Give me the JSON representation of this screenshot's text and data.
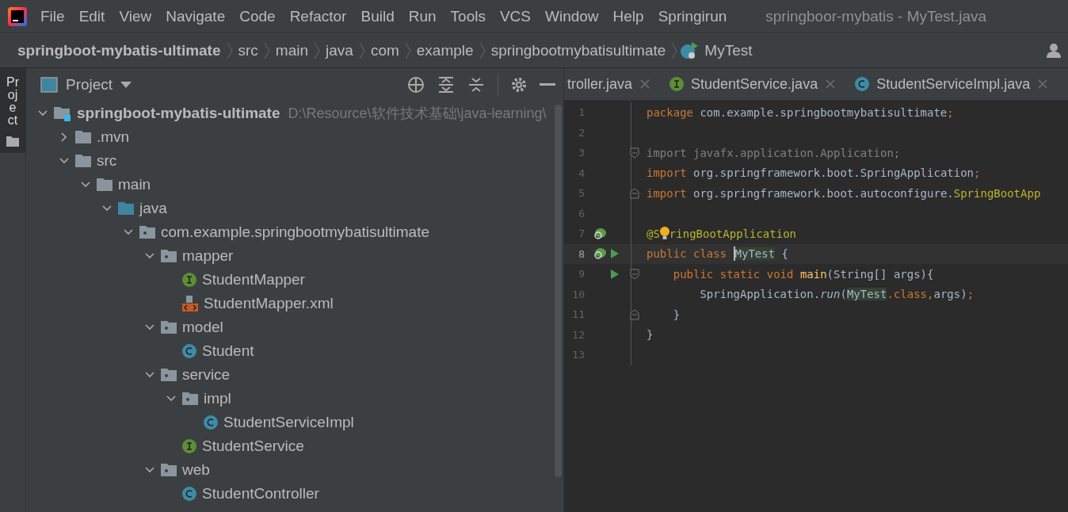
{
  "menu": {
    "items": [
      "File",
      "Edit",
      "View",
      "Navigate",
      "Code",
      "Refactor",
      "Build",
      "Run",
      "Tools",
      "VCS",
      "Window",
      "Help",
      "Springirun"
    ],
    "title": "springboor-mybatis - MyTest.java"
  },
  "breadcrumb": {
    "items": [
      {
        "label": "springboot-mybatis-ultimate",
        "kind": "project"
      },
      {
        "label": "src",
        "kind": "folder"
      },
      {
        "label": "main",
        "kind": "folder"
      },
      {
        "label": "java",
        "kind": "folder"
      },
      {
        "label": "com",
        "kind": "folder"
      },
      {
        "label": "example",
        "kind": "folder"
      },
      {
        "label": "springbootmybatisultimate",
        "kind": "folder"
      },
      {
        "label": "MyTest",
        "kind": "class"
      }
    ]
  },
  "side_strip": {
    "label": "Project"
  },
  "project_panel": {
    "title": "Project",
    "tree": [
      {
        "label": "springboot-mybatis-ultimate",
        "path": "D:\\Resource\\软件技术基础\\java-learning\\",
        "kind": "module",
        "expanded": true,
        "children": [
          {
            "label": ".mvn",
            "kind": "folder",
            "expanded": false
          },
          {
            "label": "src",
            "kind": "folder",
            "expanded": true,
            "children": [
              {
                "label": "main",
                "kind": "folder",
                "expanded": true,
                "children": [
                  {
                    "label": "java",
                    "kind": "source",
                    "expanded": true,
                    "children": [
                      {
                        "label": "com.example.springbootmybatisultimate",
                        "kind": "package",
                        "expanded": true,
                        "children": [
                          {
                            "label": "mapper",
                            "kind": "package",
                            "expanded": true,
                            "children": [
                              {
                                "label": "StudentMapper",
                                "kind": "interface"
                              },
                              {
                                "label": "StudentMapper.xml",
                                "kind": "xml"
                              }
                            ]
                          },
                          {
                            "label": "model",
                            "kind": "package",
                            "expanded": true,
                            "children": [
                              {
                                "label": "Student",
                                "kind": "class"
                              }
                            ]
                          },
                          {
                            "label": "service",
                            "kind": "package",
                            "expanded": true,
                            "children": [
                              {
                                "label": "impl",
                                "kind": "package",
                                "expanded": true,
                                "children": [
                                  {
                                    "label": "StudentServiceImpl",
                                    "kind": "class"
                                  }
                                ]
                              },
                              {
                                "label": "StudentService",
                                "kind": "interface"
                              }
                            ]
                          },
                          {
                            "label": "web",
                            "kind": "package",
                            "expanded": true,
                            "children": [
                              {
                                "label": "StudentController",
                                "kind": "class"
                              }
                            ]
                          }
                        ]
                      }
                    ]
                  }
                ]
              }
            ]
          }
        ]
      }
    ]
  },
  "editor": {
    "tabs": [
      {
        "label": "troller.java",
        "kind": "plain",
        "selected": false
      },
      {
        "label": "StudentService.java",
        "kind": "interface",
        "selected": false
      },
      {
        "label": "StudentServiceImpl.java",
        "kind": "class",
        "selected": false
      }
    ],
    "lines": [
      {
        "number": "1",
        "tokens": [
          {
            "text": "package ",
            "kind": "keyword"
          },
          {
            "text": "com.example.springbootmybatisultimate",
            "kind": "plain"
          },
          {
            "text": ";",
            "kind": "keyword"
          }
        ]
      },
      {
        "number": "2"
      },
      {
        "number": "3",
        "fold": {
          "kind": "start"
        },
        "tokens": [
          {
            "text": "import javafx.application.Application;",
            "kind": "unused"
          }
        ]
      },
      {
        "number": "4",
        "tokens": [
          {
            "text": "import ",
            "kind": "keyword"
          },
          {
            "text": "org.springframework.boot.SpringApplication",
            "kind": "plain"
          },
          {
            "text": ";",
            "kind": "keyword"
          }
        ]
      },
      {
        "number": "5",
        "fold": {
          "kind": "end"
        },
        "tokens": [
          {
            "text": "import ",
            "kind": "keyword"
          },
          {
            "text": "org.springframework.boot.autoconfigure.",
            "kind": "plain"
          },
          {
            "text": "SpringBootApp",
            "kind": "annotation"
          }
        ]
      },
      {
        "number": "6"
      },
      {
        "number": "7",
        "gutter": [
          {
            "kind": "bean"
          }
        ],
        "tokens": [
          {
            "text": "@S",
            "kind": "annotation"
          },
          {
            "kind": "bulb"
          },
          {
            "text": "ringBootApplication",
            "kind": "annotation"
          }
        ]
      },
      {
        "number": "8",
        "gutter": [
          {
            "kind": "bean"
          },
          {
            "kind": "run"
          }
        ],
        "current": true,
        "tokens": [
          {
            "text": "public class ",
            "kind": "keyword"
          },
          {
            "kind": "caret"
          },
          {
            "text": "MyTest",
            "kind": "highlight"
          },
          {
            "text": " {",
            "kind": "plain"
          }
        ]
      },
      {
        "number": "9",
        "gutter": [
          {
            "kind": "spacer"
          },
          {
            "kind": "run"
          }
        ],
        "fold": {
          "kind": "start"
        },
        "tokens": [
          {
            "text": "    public static void ",
            "kind": "keyword"
          },
          {
            "text": "main",
            "kind": "method"
          },
          {
            "text": "(String[] args){",
            "kind": "plain"
          }
        ]
      },
      {
        "number": "10",
        "tokens": [
          {
            "text": "        SpringApplication.",
            "kind": "plain"
          },
          {
            "text": "run",
            "kind": "italic"
          },
          {
            "text": "(",
            "kind": "plain"
          },
          {
            "text": "MyTest",
            "kind": "highlight"
          },
          {
            "text": ".class,",
            "kind": "keyword"
          },
          {
            "text": "args)",
            "kind": "plain"
          },
          {
            "text": ";",
            "kind": "keyword"
          }
        ]
      },
      {
        "number": "11",
        "fold": {
          "kind": "end"
        },
        "tokens": [
          {
            "text": "    }",
            "kind": "plain"
          }
        ]
      },
      {
        "number": "12",
        "tokens": [
          {
            "text": "}",
            "kind": "plain"
          }
        ]
      },
      {
        "number": "13"
      }
    ]
  }
}
